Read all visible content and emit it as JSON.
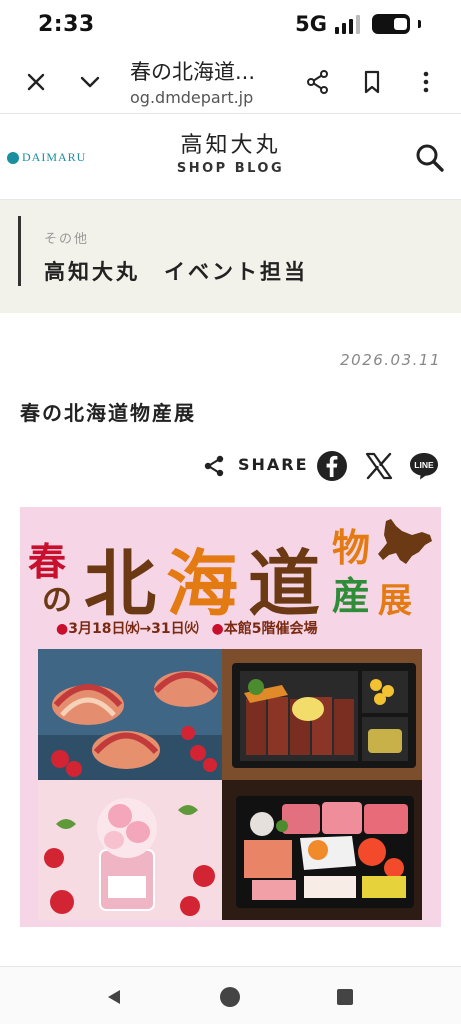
{
  "status_bar": {
    "time": "2:33",
    "network": "5G"
  },
  "browser": {
    "page_title": "春の北海道...",
    "url": "og.dmdepart.jp",
    "close_icon": "close-icon",
    "expand_icon": "chevron-down-icon",
    "share_icon": "share-icon",
    "bookmark_icon": "bookmark-icon",
    "more_icon": "more-vertical-icon"
  },
  "site": {
    "logo_text": "DAIMARU",
    "name": "高知大丸",
    "subtitle": "SHOP BLOG",
    "search_icon": "search-icon"
  },
  "category": {
    "label": "その他",
    "author": "高知大丸　イベント担当"
  },
  "article": {
    "date": "2026.03.11",
    "title": "春の北海道物産展",
    "share_label": "SHARE",
    "share_buttons": [
      "facebook-icon",
      "x-icon",
      "line-icon"
    ],
    "line_label": "LINE"
  },
  "poster": {
    "title_parts": [
      "春",
      "の",
      "北",
      "海",
      "道",
      "物",
      "産",
      "展"
    ],
    "dates": "3月18日㈬→31日㈫",
    "venue": "本館5階催会場",
    "colors": {
      "background": "#f6d6e6",
      "red": "#c8102e",
      "brown": "#6b3a14",
      "orange": "#e37a12",
      "green": "#2f8d3a"
    }
  },
  "nav": {
    "back_icon": "back-icon",
    "home_icon": "home-icon",
    "recent_icon": "recent-apps-icon"
  }
}
